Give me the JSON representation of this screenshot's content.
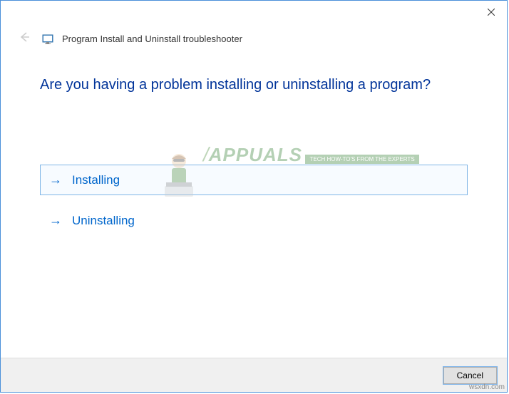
{
  "window": {
    "title": "Program Install and Uninstall troubleshooter"
  },
  "content": {
    "heading": "Are you having a problem installing or uninstalling a program?",
    "options": [
      {
        "label": "Installing",
        "selected": true
      },
      {
        "label": "Uninstalling",
        "selected": false
      }
    ]
  },
  "footer": {
    "cancel_label": "Cancel"
  },
  "watermark": {
    "brand": "APPUALS",
    "sub": "TECH HOW-TO'S FROM THE EXPERTS"
  },
  "source": "wsxdn.com"
}
